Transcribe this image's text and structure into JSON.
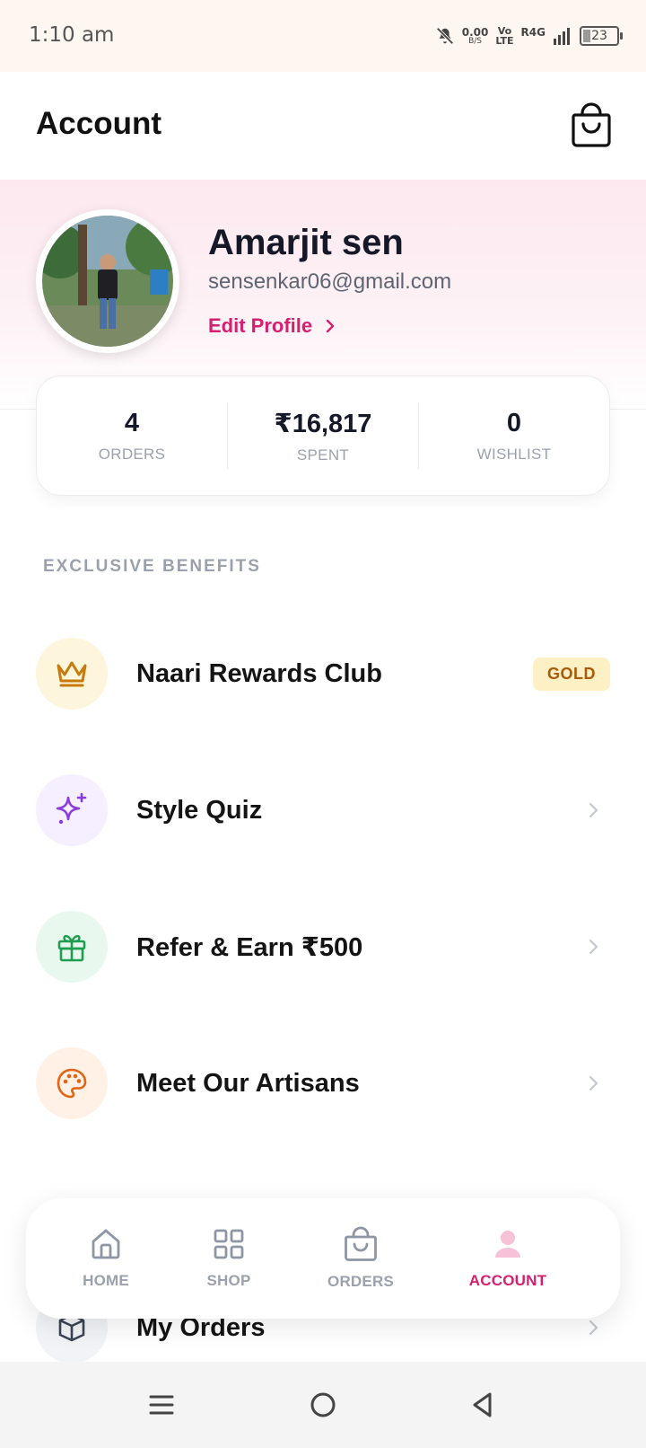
{
  "status_bar": {
    "time": "1:10 am",
    "net_speed_value": "0.00",
    "net_speed_unit": "B/S",
    "volte_top": "Vo",
    "volte_bottom": "LTE",
    "network": "R4G",
    "battery": "23"
  },
  "header": {
    "title": "Account",
    "cart_icon": "shopping-bag-icon"
  },
  "profile": {
    "name": "Amarjit sen",
    "email": "sensenkar06@gmail.com",
    "edit_label": "Edit Profile"
  },
  "stats": [
    {
      "value": "4",
      "label": "ORDERS"
    },
    {
      "value": "₹16,817",
      "label": "SPENT"
    },
    {
      "value": "0",
      "label": "WISHLIST"
    }
  ],
  "benefits": {
    "section_title": "EXCLUSIVE BENEFITS",
    "items": [
      {
        "label": "Naari Rewards Club",
        "icon": "crown-icon",
        "badge": "GOLD",
        "icon_bg": "#fdf6dc",
        "icon_color": "#c77a0c"
      },
      {
        "label": "Style Quiz",
        "icon": "sparkles-icon",
        "icon_bg": "#f6efff",
        "icon_color": "#8b3ddb"
      },
      {
        "label": "Refer & Earn ₹500",
        "icon": "gift-icon",
        "icon_bg": "#e9f8ef",
        "icon_color": "#1f9d50"
      },
      {
        "label": "Meet Our Artisans",
        "icon": "palette-icon",
        "icon_bg": "#fff1e6",
        "icon_color": "#e36414"
      }
    ]
  },
  "orders_row": {
    "label": "My Orders",
    "icon": "box-icon"
  },
  "bottom_nav": {
    "items": [
      {
        "label": "HOME",
        "icon": "home-icon"
      },
      {
        "label": "SHOP",
        "icon": "grid-icon"
      },
      {
        "label": "ORDERS",
        "icon": "bag-icon"
      },
      {
        "label": "ACCOUNT",
        "icon": "user-icon",
        "active": true
      }
    ]
  },
  "colors": {
    "accent": "#d61f6e",
    "muted": "#9aa1ad",
    "text": "#141827"
  }
}
